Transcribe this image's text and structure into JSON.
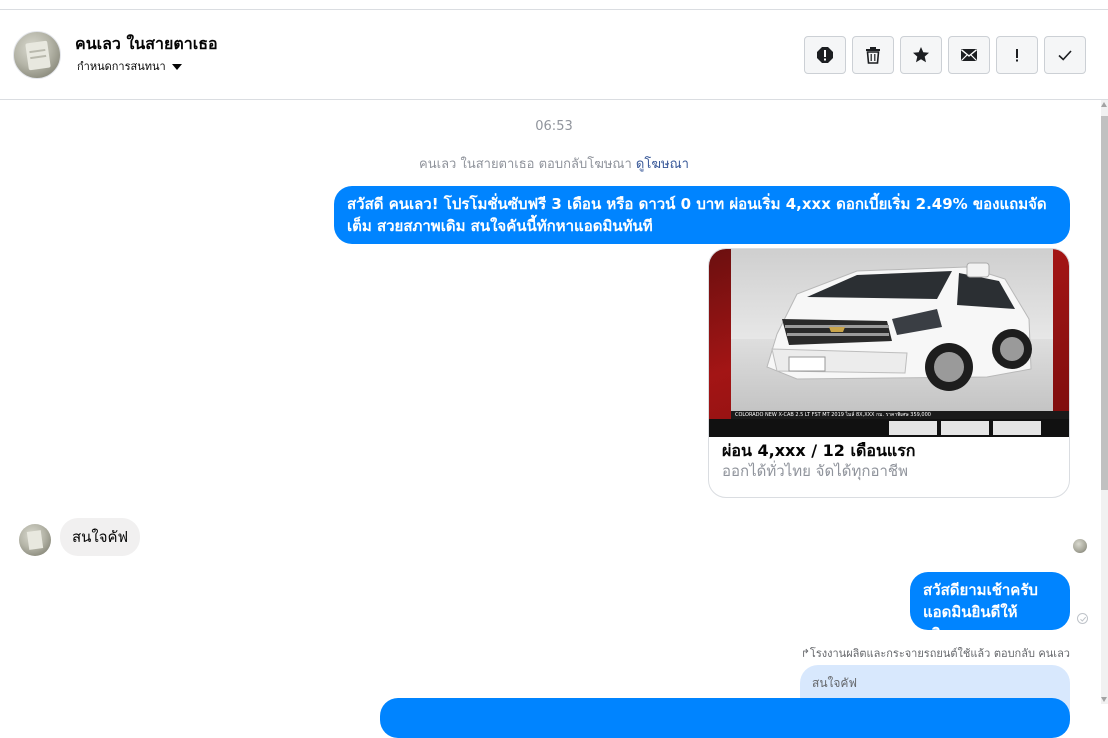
{
  "header": {
    "name": "คนเลว ในสายตาเธอ",
    "subtitle": "กำหนดการสนทนา",
    "toolbar": [
      {
        "icon": "spam-report-icon"
      },
      {
        "icon": "trash-icon"
      },
      {
        "icon": "star-icon"
      },
      {
        "icon": "envelope-icon"
      },
      {
        "icon": "exclamation-icon"
      },
      {
        "icon": "checkmark-icon"
      }
    ]
  },
  "thread": {
    "timestamp": "06:53",
    "ad_reply_text": "คนเลว ในสายตาเธอ ตอบกลับโฆษณา",
    "ad_link": "ดูโฆษณา",
    "message1": "สวัสดี คนเลว! โปรโมชั่นซับฟรี 3 เดือน หรือ ดาวน์ 0 บาท ผ่อนเริ่ม 4,xxx ดอกเบี้ยเริ่ม 2.49% ของแถมจัดเต็ม สวยสภาพเดิม สนใจคันนี้ทักหาแอดมินทันที",
    "card": {
      "title": "ผ่อน 4,xxx / 12 เดือนแรก",
      "description": "ออกได้ทั่วไทย จัดได้ทุกอาชีพ",
      "image_caption": "COLORADO NEW X-CAB 2.5 LT FST MT 2019 ไมล์ 8X,XXX กม. ราคาพิเศษ 359,000"
    },
    "incoming1": "สนใจคัฟ",
    "outgoing2_line1": "สวัสดียามเช้าครับ",
    "outgoing2_line2": "แอดมินยินดีให้บริการ",
    "reply_header": "↱โรงงานผลิตและกระจายรถยนต์ใช้แล้ว ตอบกลับ คนเลว",
    "quoted": "สนใจคัฟ"
  },
  "colors": {
    "outgoing_bubble": "#0084ff",
    "incoming_bubble": "#f1f0f0",
    "link": "#385898",
    "muted": "#90949c"
  }
}
